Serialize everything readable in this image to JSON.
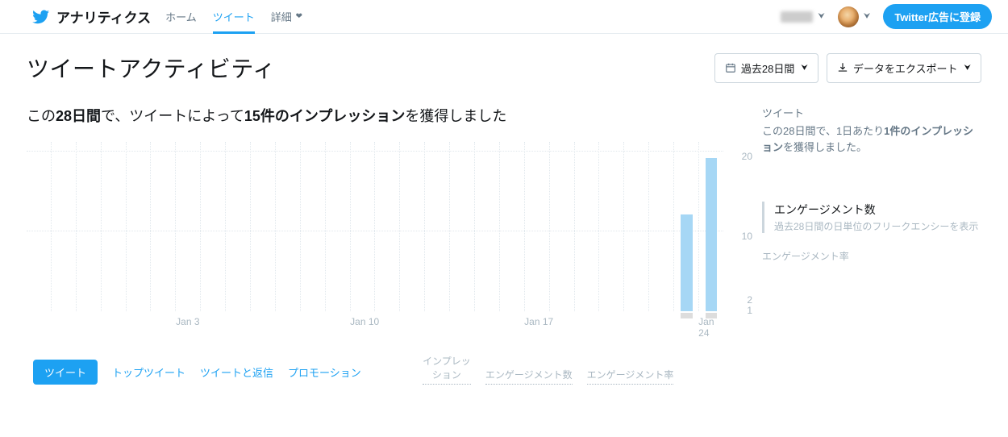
{
  "nav": {
    "brand": "アナリティクス",
    "home": "ホーム",
    "tweets": "ツイート",
    "more": "詳細",
    "ad_button": "Twitter広告に登録"
  },
  "header": {
    "title": "ツイートアクティビティ",
    "date_range": "過去28日間",
    "export": "データをエクスポート"
  },
  "summary": {
    "prefix": "この",
    "period": "28日間",
    "mid1": "で、ツイートによって",
    "count": "15件のインプレッション",
    "suffix": "を獲得しました"
  },
  "sidebar_chart": {
    "head": "ツイート",
    "text_pre": "この28日間で、1日あたり",
    "text_bold": "1件のインプレッション",
    "text_post": "を獲得しました。"
  },
  "tabs": {
    "tweets": "ツイート",
    "top_tweets": "トップツイート",
    "replies": "ツイートと返信",
    "promo": "プロモーション",
    "impressions": "インプレッション",
    "engagements": "エンゲージメント数",
    "eng_rate": "エンゲージメント率"
  },
  "side_section": {
    "title": "エンゲージメント数",
    "sub": "過去28日間の日単位のフリークエンシーを表示",
    "cut": "エンゲージメント率"
  },
  "chart_data": {
    "type": "bar",
    "categories_shown": [
      "Jan 3",
      "Jan 10",
      "Jan 17",
      "Jan 24"
    ],
    "y_ticks_primary": [
      10,
      20
    ],
    "y_ticks_secondary": [
      1,
      2
    ],
    "y_max_primary": 20,
    "y_max_secondary": 2,
    "series": [
      {
        "name": "impressions",
        "x": [
          "Jan 23",
          "Jan 24"
        ],
        "values": [
          12,
          19
        ],
        "color": "#a6d7f5"
      },
      {
        "name": "tweets",
        "x": [
          "Jan 23",
          "Jan 24"
        ],
        "values": [
          1,
          1
        ],
        "color": "#d9d9d9"
      }
    ],
    "xlabel": "",
    "ylabel": ""
  }
}
